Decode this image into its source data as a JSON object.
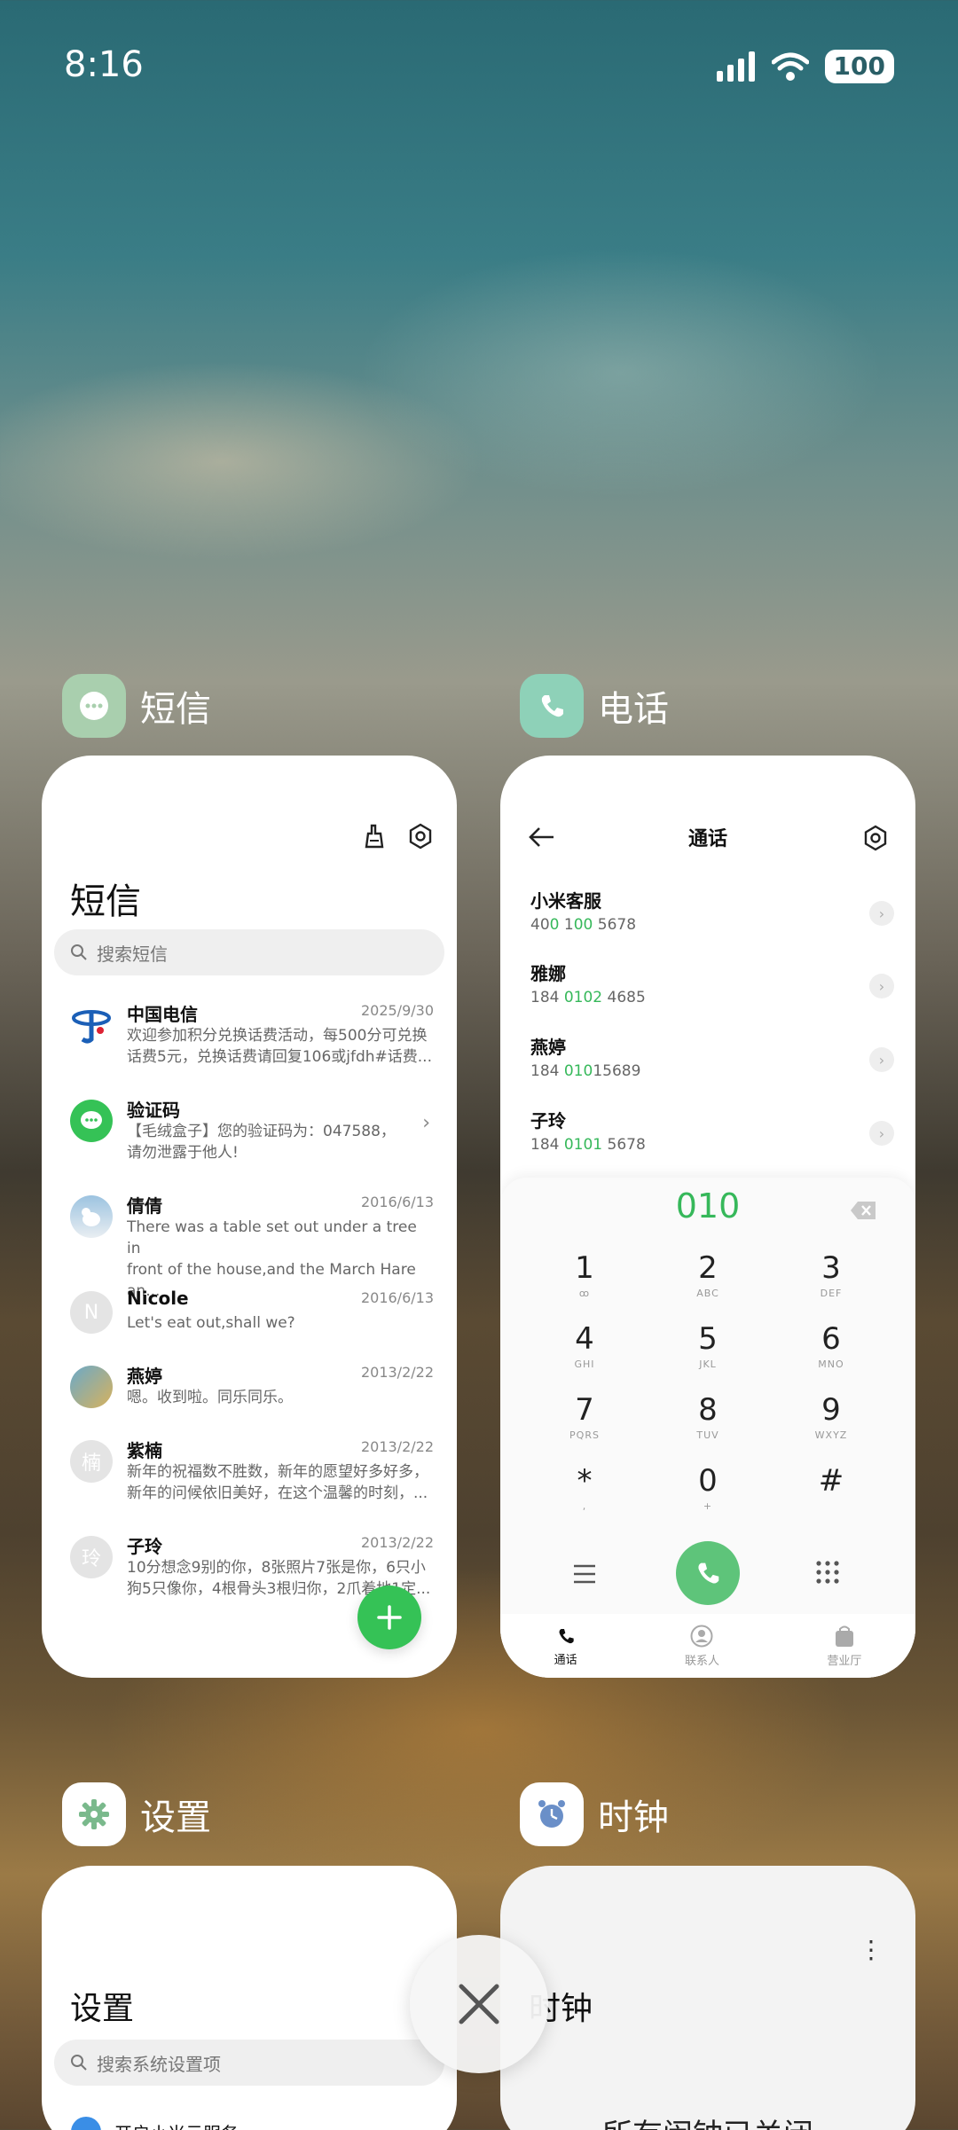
{
  "status_bar": {
    "time": "8:16",
    "battery": "100"
  },
  "apps": {
    "sms": {
      "label": "短信"
    },
    "phone": {
      "label": "电话"
    },
    "settings": {
      "label": "设置"
    },
    "clock": {
      "label": "时钟"
    }
  },
  "sms": {
    "title": "短信",
    "search_placeholder": "搜索短信",
    "messages": [
      {
        "name": "中国电信",
        "date": "2025/9/30",
        "body": "欢迎参加积分兑换话费活动，每500分可兑换\n话费5元，兑换话费请回复106或jfdh#话费..."
      },
      {
        "name": "验证码",
        "date": "",
        "body": "【毛绒盒子】您的验证码为：047588，\n请勿泄露于他人!"
      },
      {
        "name": "倩倩",
        "date": "2016/6/13",
        "body": "There was a table set out under a tree in\nfront of the house,and the March Hare an..."
      },
      {
        "name": "Nicole",
        "date": "2016/6/13",
        "body": "Let's eat out,shall we?"
      },
      {
        "name": "燕婷",
        "date": "2013/2/22",
        "body": "嗯。收到啦。同乐同乐。"
      },
      {
        "name": "紫楠",
        "date": "2013/2/22",
        "body": "新年的祝福数不胜数，新年的愿望好多好多，\n新年的问候依旧美好，在这个温馨的时刻，..."
      },
      {
        "name": "子玲",
        "date": "2013/2/22",
        "body": "10分想念9别的你，8张照片7张是你，6只小\n狗5只像你，4根骨头3根归你，2爪着地1定..."
      }
    ],
    "avatars": {
      "n": "N",
      "zinan": "楠",
      "ziling": "玲"
    }
  },
  "phone": {
    "title": "通话",
    "contacts": [
      {
        "name": "小米客服",
        "num_pre": "40",
        "num_hl": "0",
        "num_mid": " 1",
        "num_hl2": "00",
        "num_post": " 5678"
      },
      {
        "name": "雅娜",
        "num_pre": "184 ",
        "num_hl": "0102",
        "num_mid": "",
        "num_hl2": "",
        "num_post": " 4685"
      },
      {
        "name": "燕婷",
        "num_pre": "184 ",
        "num_hl": "010",
        "num_mid": "",
        "num_hl2": "",
        "num_post": "15689"
      },
      {
        "name": "子玲",
        "num_pre": "184 ",
        "num_hl": "0101",
        "num_mid": "",
        "num_hl2": "",
        "num_post": " 5678"
      }
    ],
    "dial_number": "010",
    "keys": [
      {
        "d": "1",
        "l": "ꝏ"
      },
      {
        "d": "2",
        "l": "ABC"
      },
      {
        "d": "3",
        "l": "DEF"
      },
      {
        "d": "4",
        "l": "GHI"
      },
      {
        "d": "5",
        "l": "JKL"
      },
      {
        "d": "6",
        "l": "MNO"
      },
      {
        "d": "7",
        "l": "PQRS"
      },
      {
        "d": "8",
        "l": "TUV"
      },
      {
        "d": "9",
        "l": "WXYZ"
      },
      {
        "d": "*",
        "l": ","
      },
      {
        "d": "0",
        "l": "+"
      },
      {
        "d": "#",
        "l": ""
      }
    ],
    "nav": {
      "calls": "通话",
      "contacts": "联系人",
      "hall": "营业厅"
    }
  },
  "settings": {
    "title": "设置",
    "search_placeholder": "搜索系统设置项",
    "first_item": "开启小米云服务"
  },
  "clock": {
    "title": "时钟",
    "empty": "所有闹钟已关闭"
  },
  "colors": {
    "accent_green": "#35c256",
    "number_highlight": "#36b85a"
  }
}
